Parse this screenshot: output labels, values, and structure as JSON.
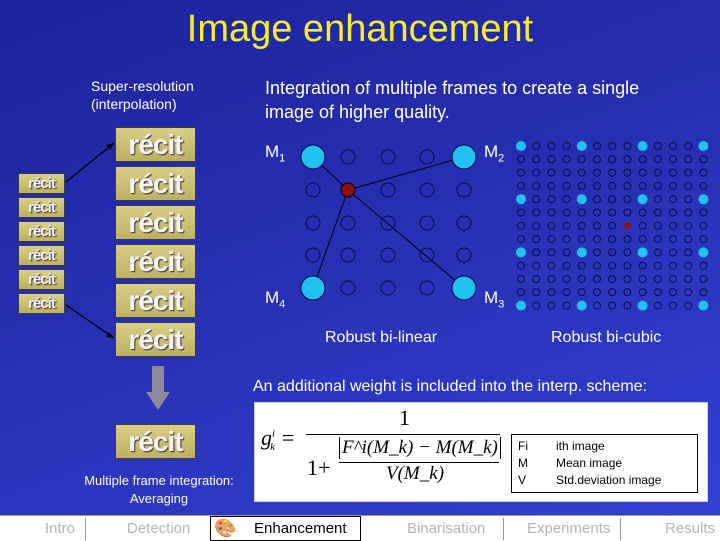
{
  "title": "Image enhancement",
  "left_caption": [
    "Super-resolution",
    "(interpolation)"
  ],
  "intro_text": [
    "Integration of multiple frames to create a single",
    "image of higher quality."
  ],
  "frame_label": "récit",
  "labels": {
    "m1": "M",
    "m1_sub": "1",
    "m2": "M",
    "m2_sub": "2",
    "m3": "M",
    "m3_sub": "3",
    "m4": "M",
    "m4_sub": "4"
  },
  "bilinear_caption": "Robust bi-linear",
  "bicubic_caption": "Robust bi-cubic",
  "weight_text": "An additional weight is included into the interp. scheme:",
  "averaging_caption": [
    "Multiple frame integration:",
    "Averaging"
  ],
  "formula": {
    "lhs": "g",
    "lhs_sup": "i",
    "lhs_sub": "k",
    "numerator": "1",
    "denominator_prefix": "1+",
    "inner_num": "F^i(M_k) − M(M_k)",
    "inner_den": "V(M_k)"
  },
  "legend": [
    {
      "sym": "Fi",
      "desc": "ith image"
    },
    {
      "sym": "M",
      "desc": "Mean image"
    },
    {
      "sym": "V",
      "desc": "Std.deviation image"
    }
  ],
  "nav": {
    "items": [
      "Intro",
      "Detection",
      "Enhancement",
      "Binarisation",
      "Experiments",
      "Results"
    ],
    "active": "Enhancement"
  },
  "colors": {
    "title": "#f4ee2a",
    "sample_point": "#22c2f0",
    "interp_point": "#8b1010",
    "background": "#2830b4"
  }
}
